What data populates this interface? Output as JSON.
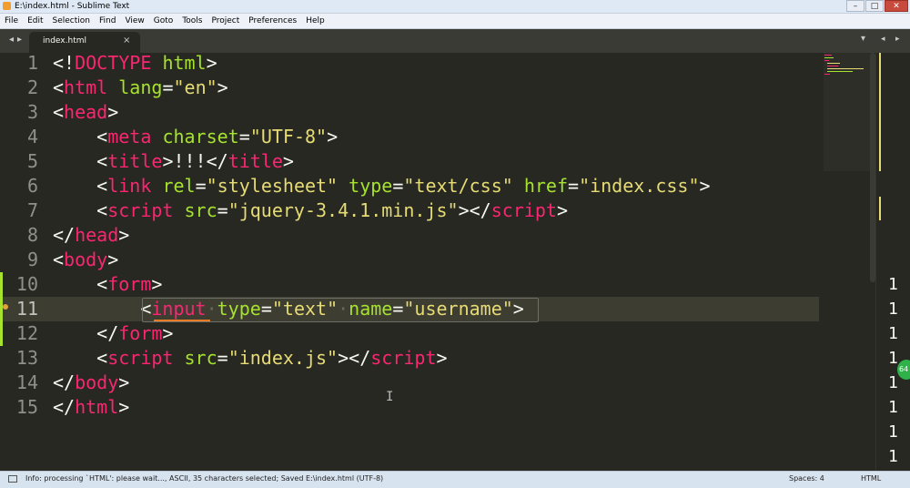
{
  "window": {
    "title": "E:\\index.html - Sublime Text"
  },
  "menu": [
    "File",
    "Edit",
    "Selection",
    "Find",
    "View",
    "Goto",
    "Tools",
    "Project",
    "Preferences",
    "Help"
  ],
  "tabs": [
    {
      "label": "index.html",
      "close": "×"
    }
  ],
  "code_lines": [
    {
      "num": "1",
      "tokens": [
        [
          "p",
          "<!"
        ],
        [
          "t",
          "DOCTYPE"
        ],
        [
          "p",
          " "
        ],
        [
          "a",
          "html"
        ],
        [
          "p",
          ">"
        ]
      ]
    },
    {
      "num": "2",
      "tokens": [
        [
          "p",
          "<"
        ],
        [
          "t",
          "html"
        ],
        [
          "p",
          " "
        ],
        [
          "a",
          "lang"
        ],
        [
          "p",
          "="
        ],
        [
          "s",
          "\"en\""
        ],
        [
          "p",
          ">"
        ]
      ]
    },
    {
      "num": "3",
      "tokens": [
        [
          "p",
          "<"
        ],
        [
          "t",
          "head"
        ],
        [
          "p",
          ">"
        ]
      ]
    },
    {
      "num": "4",
      "tokens": [
        [
          "p",
          "    <"
        ],
        [
          "t",
          "meta"
        ],
        [
          "p",
          " "
        ],
        [
          "a",
          "charset"
        ],
        [
          "p",
          "="
        ],
        [
          "s",
          "\"UTF-8\""
        ],
        [
          "p",
          ">"
        ]
      ]
    },
    {
      "num": "5",
      "tokens": [
        [
          "p",
          "    <"
        ],
        [
          "t",
          "title"
        ],
        [
          "p",
          ">!!!</"
        ],
        [
          "t",
          "title"
        ],
        [
          "p",
          ">"
        ]
      ]
    },
    {
      "num": "6",
      "tokens": [
        [
          "p",
          "    <"
        ],
        [
          "t",
          "link"
        ],
        [
          "p",
          " "
        ],
        [
          "a",
          "rel"
        ],
        [
          "p",
          "="
        ],
        [
          "s",
          "\"stylesheet\""
        ],
        [
          "p",
          " "
        ],
        [
          "a",
          "type"
        ],
        [
          "p",
          "="
        ],
        [
          "s",
          "\"text/css\""
        ],
        [
          "p",
          " "
        ],
        [
          "a",
          "href"
        ],
        [
          "p",
          "="
        ],
        [
          "s",
          "\"index.css\""
        ],
        [
          "p",
          ">"
        ]
      ]
    },
    {
      "num": "7",
      "tokens": [
        [
          "p",
          "    <"
        ],
        [
          "t",
          "script"
        ],
        [
          "p",
          " "
        ],
        [
          "a",
          "src"
        ],
        [
          "p",
          "="
        ],
        [
          "s",
          "\"jquery-3.4.1.min.js\""
        ],
        [
          "p",
          "></"
        ],
        [
          "t",
          "script"
        ],
        [
          "p",
          ">"
        ]
      ]
    },
    {
      "num": "8",
      "tokens": [
        [
          "p",
          "</"
        ],
        [
          "t",
          "head"
        ],
        [
          "p",
          ">"
        ]
      ]
    },
    {
      "num": "9",
      "tokens": [
        [
          "p",
          "<"
        ],
        [
          "t",
          "body"
        ],
        [
          "p",
          ">"
        ]
      ]
    },
    {
      "num": "10",
      "tokens": [
        [
          "p",
          "    <"
        ],
        [
          "t",
          "form"
        ],
        [
          "p",
          ">"
        ]
      ]
    },
    {
      "num": "11",
      "tokens": [
        [
          "p",
          "        <"
        ],
        [
          "t",
          "input"
        ],
        [
          "c-dot",
          "·"
        ],
        [
          "a",
          "type"
        ],
        [
          "p",
          "="
        ],
        [
          "s",
          "\"text\""
        ],
        [
          "c-dot",
          "·"
        ],
        [
          "a",
          "name"
        ],
        [
          "p",
          "="
        ],
        [
          "s",
          "\"username\""
        ],
        [
          "p",
          ">"
        ]
      ]
    },
    {
      "num": "12",
      "tokens": [
        [
          "p",
          "    </"
        ],
        [
          "t",
          "form"
        ],
        [
          "p",
          ">"
        ]
      ]
    },
    {
      "num": "13",
      "tokens": [
        [
          "p",
          "    <"
        ],
        [
          "t",
          "script"
        ],
        [
          "p",
          " "
        ],
        [
          "a",
          "src"
        ],
        [
          "p",
          "="
        ],
        [
          "s",
          "\"index.js\""
        ],
        [
          "p",
          "></"
        ],
        [
          "t",
          "script"
        ],
        [
          "p",
          ">"
        ]
      ]
    },
    {
      "num": "14",
      "tokens": [
        [
          "p",
          "</"
        ],
        [
          "t",
          "body"
        ],
        [
          "p",
          ">"
        ]
      ]
    },
    {
      "num": "15",
      "tokens": [
        [
          "p",
          "</"
        ],
        [
          "t",
          "html"
        ],
        [
          "p",
          ">"
        ]
      ]
    }
  ],
  "active_line": 11,
  "right_pane_lines": [
    "1",
    "1",
    "1",
    "1",
    "1",
    "1",
    "1",
    "1"
  ],
  "badge": "64",
  "status": {
    "message": "Info: processing `HTML': please wait..., ASCII, 35 characters selected; Saved E:\\index.html (UTF-8)",
    "spaces": "Spaces: 4",
    "syntax": "HTML"
  },
  "colors": {
    "tag": "#f92672",
    "attr": "#a6e22e",
    "string": "#e6db74",
    "background": "#272822"
  }
}
